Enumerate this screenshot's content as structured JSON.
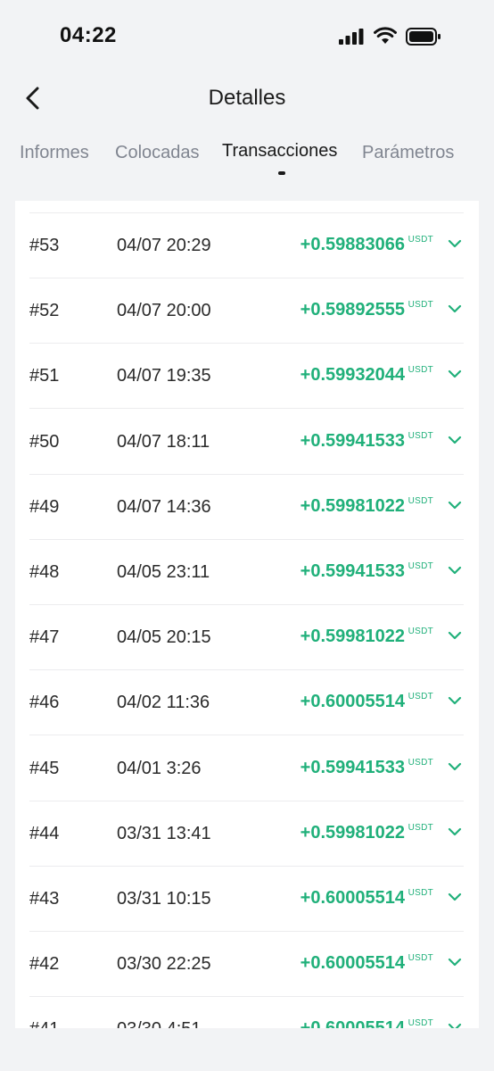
{
  "status_bar": {
    "time": "04:22",
    "icons": [
      "signal-icon",
      "wifi-icon",
      "battery-icon"
    ]
  },
  "nav": {
    "title": "Detalles",
    "back_icon": "chevron-left-icon"
  },
  "tabs": [
    {
      "label": "Informes",
      "active": false
    },
    {
      "label": "Colocadas",
      "active": false
    },
    {
      "label": "Transacciones",
      "active": true
    },
    {
      "label": "Parámetros",
      "active": false
    }
  ],
  "transactions": {
    "unit": "USDT",
    "accent_color": "#20b07a",
    "rows": [
      {
        "id": "#53",
        "date": "04/07 20:29",
        "amount": "+0.59883066"
      },
      {
        "id": "#52",
        "date": "04/07 20:00",
        "amount": "+0.59892555"
      },
      {
        "id": "#51",
        "date": "04/07 19:35",
        "amount": "+0.59932044"
      },
      {
        "id": "#50",
        "date": "04/07 18:11",
        "amount": "+0.59941533"
      },
      {
        "id": "#49",
        "date": "04/07 14:36",
        "amount": "+0.59981022"
      },
      {
        "id": "#48",
        "date": "04/05 23:11",
        "amount": "+0.59941533"
      },
      {
        "id": "#47",
        "date": "04/05 20:15",
        "amount": "+0.59981022"
      },
      {
        "id": "#46",
        "date": "04/02 11:36",
        "amount": "+0.60005514"
      },
      {
        "id": "#45",
        "date": "04/01 3:26",
        "amount": "+0.59941533"
      },
      {
        "id": "#44",
        "date": "03/31 13:41",
        "amount": "+0.59981022"
      },
      {
        "id": "#43",
        "date": "03/31 10:15",
        "amount": "+0.60005514"
      },
      {
        "id": "#42",
        "date": "03/30 22:25",
        "amount": "+0.60005514"
      },
      {
        "id": "#41",
        "date": "03/30 4:51",
        "amount": "+0.60005514"
      }
    ]
  }
}
